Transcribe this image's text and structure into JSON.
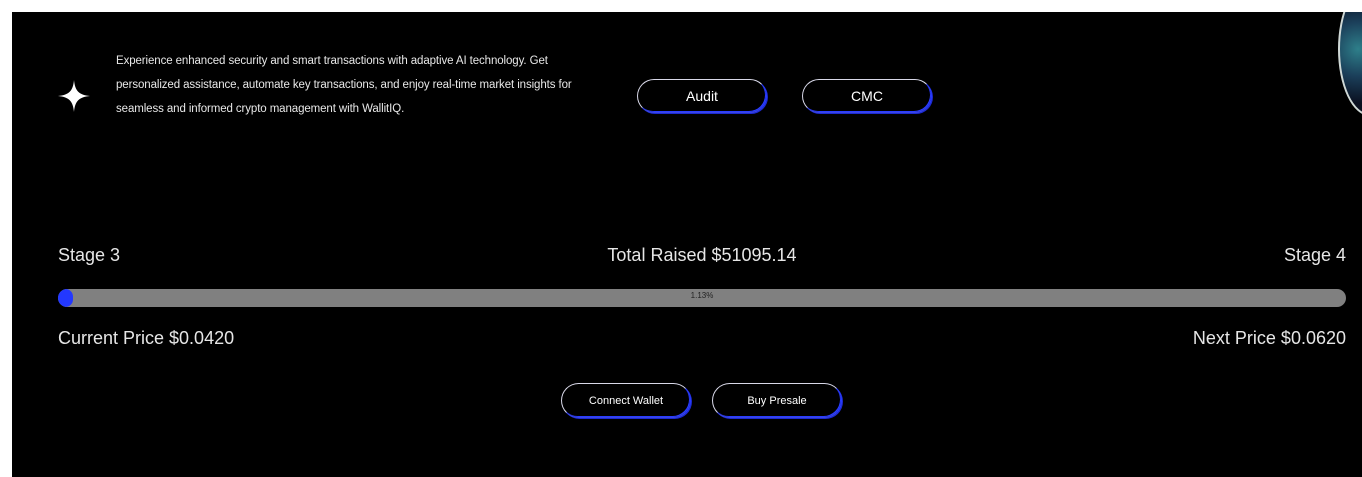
{
  "intro": {
    "description": "Experience enhanced security and smart transactions with adaptive AI technology. Get personalized assistance, automate key transactions, and enjoy real-time market insights for seamless and informed crypto management with WallitIQ.",
    "icon": "sparkle-icon"
  },
  "links": {
    "audit_label": "Audit",
    "cmc_label": "CMC"
  },
  "presale": {
    "current_stage": "Stage 3",
    "total_raised": "Total Raised $51095.14",
    "next_stage": "Stage 4",
    "progress_percent": 1.13,
    "progress_label": "1.13%",
    "current_price": "Current Price $0.0420",
    "next_price": "Next Price $0.0620"
  },
  "actions": {
    "connect_label": "Connect Wallet",
    "buy_label": "Buy Presale"
  },
  "colors": {
    "background": "#000000",
    "accent": "#2338ff",
    "track": "#808080"
  }
}
